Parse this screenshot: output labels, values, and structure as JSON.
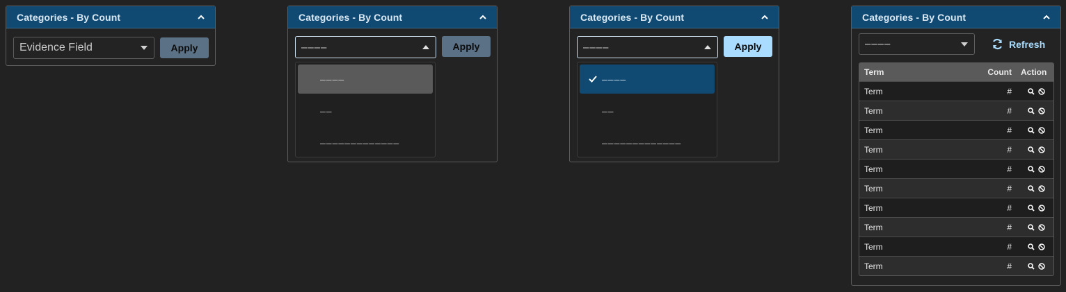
{
  "panels": [
    {
      "title": "Categories - By Count",
      "select_value": "Evidence Field",
      "apply_label": "Apply"
    },
    {
      "title": "Categories - By Count",
      "select_value": "––––",
      "apply_label": "Apply",
      "options": [
        "––––",
        "––",
        "–––––––––––––"
      ]
    },
    {
      "title": "Categories - By Count",
      "select_value": "––––",
      "apply_label": "Apply",
      "options": [
        "––––",
        "––",
        "–––––––––––––"
      ]
    },
    {
      "title": "Categories - By Count",
      "select_value": "––––",
      "refresh_label": "Refresh",
      "table": {
        "headers": {
          "term": "Term",
          "count": "Count",
          "action": "Action"
        },
        "rows": [
          {
            "term": "Term",
            "count": "#"
          },
          {
            "term": "Term",
            "count": "#"
          },
          {
            "term": "Term",
            "count": "#"
          },
          {
            "term": "Term",
            "count": "#"
          },
          {
            "term": "Term",
            "count": "#"
          },
          {
            "term": "Term",
            "count": "#"
          },
          {
            "term": "Term",
            "count": "#"
          },
          {
            "term": "Term",
            "count": "#"
          },
          {
            "term": "Term",
            "count": "#"
          },
          {
            "term": "Term",
            "count": "#"
          }
        ]
      }
    }
  ],
  "colors": {
    "header_bg": "#104a73",
    "accent": "#a9dcff",
    "apply_muted": "#5b7185",
    "selected_option": "#104a73",
    "hover_option": "#5a5a5a"
  },
  "icons": [
    "chevron-up-icon",
    "caret-down-icon",
    "caret-up-icon",
    "check-icon",
    "refresh-icon",
    "search-icon",
    "ban-icon"
  ]
}
